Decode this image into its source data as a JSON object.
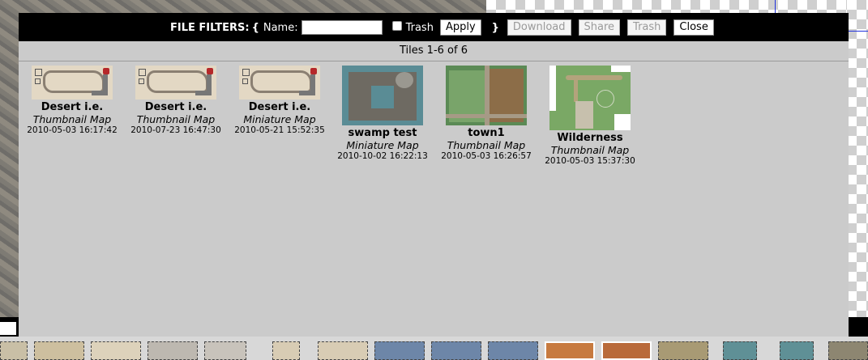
{
  "filters": {
    "title": "FILE FILTERS:",
    "open_brace": "{",
    "close_brace": "}",
    "name_label": "Name:",
    "name_value": "",
    "trash_label": "Trash",
    "trash_checked": false,
    "buttons": {
      "apply": "Apply",
      "download": "Download",
      "share": "Share",
      "trash": "Trash",
      "close": "Close"
    }
  },
  "tiles_count": "Tiles 1-6 of 6",
  "tiles": [
    {
      "name": "Desert i.e.",
      "type": "Thumbnail Map",
      "date": "2010-05-03 16:17:42",
      "thumb": "desert-map-thumbnail"
    },
    {
      "name": "Desert i.e.",
      "type": "Thumbnail Map",
      "date": "2010-07-23 16:47:30",
      "thumb": "desert-map-thumbnail"
    },
    {
      "name": "Desert i.e.",
      "type": "Miniature Map",
      "date": "2010-05-21 15:52:35",
      "thumb": "desert-map-thumbnail"
    },
    {
      "name": "swamp test",
      "type": "Miniature Map",
      "date": "2010-10-02 16:22:13",
      "thumb": "swamp-map-thumbnail"
    },
    {
      "name": "town1",
      "type": "Thumbnail Map",
      "date": "2010-05-03 16:26:57",
      "thumb": "town-map-thumbnail"
    },
    {
      "name": "Wilderness",
      "type": "Thumbnail Map",
      "date": "2010-05-03 15:37:30",
      "thumb": "wilderness-map-thumbnail"
    }
  ],
  "colors": {
    "filter_bar_bg": "#000000",
    "dialog_bg": "#cbcbcb",
    "disabled_text": "#9a9a9a"
  }
}
